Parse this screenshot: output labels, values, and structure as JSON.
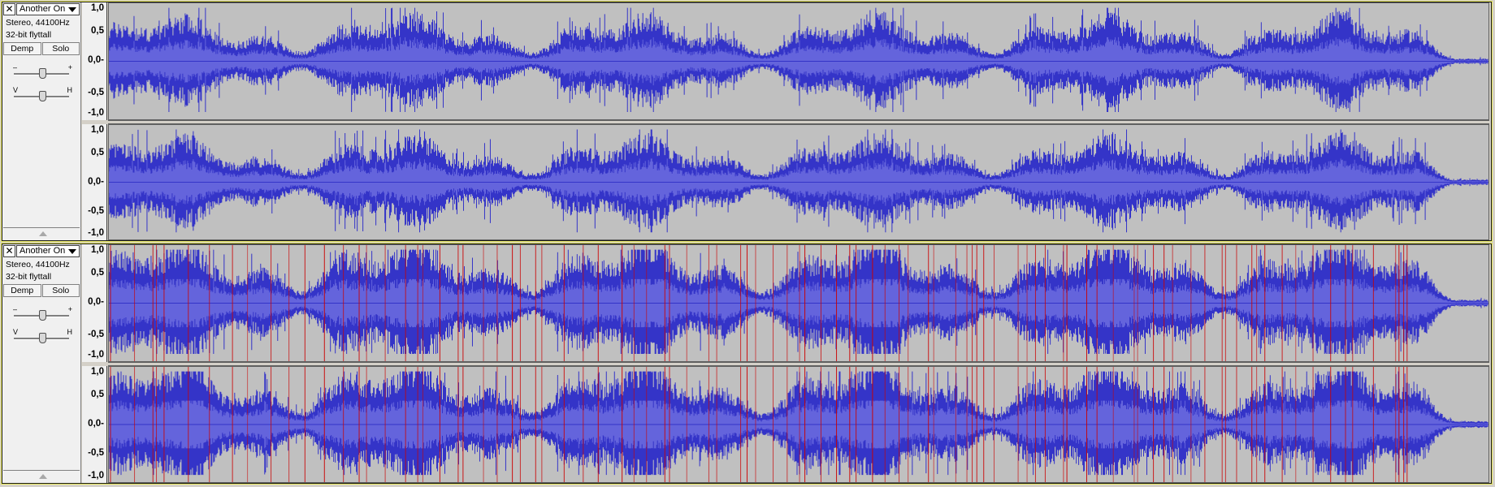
{
  "tracks": [
    {
      "name": "Another On",
      "format": "Stereo, 44100Hz",
      "sample_format": "32-bit flyttall",
      "mute_label": "Demp",
      "solo_label": "Solo",
      "gain_minus": "–",
      "gain_plus": "+",
      "pan_left": "V",
      "pan_right": "H",
      "has_beat_marks": false
    },
    {
      "name": "Another On",
      "format": "Stereo, 44100Hz",
      "sample_format": "32-bit flyttall",
      "mute_label": "Demp",
      "solo_label": "Solo",
      "gain_minus": "–",
      "gain_plus": "+",
      "pan_left": "V",
      "pan_right": "H",
      "has_beat_marks": true
    }
  ],
  "ruler_ticks": [
    "1,0",
    "0,5",
    "0,0-",
    "-0,5",
    "-1,0"
  ],
  "colors": {
    "waveform": "#3434c8",
    "waveform_rms": "#6464dc",
    "background": "#c0c0c0",
    "beat_mark": "#cc0000",
    "selected_border": "#e8e860"
  }
}
